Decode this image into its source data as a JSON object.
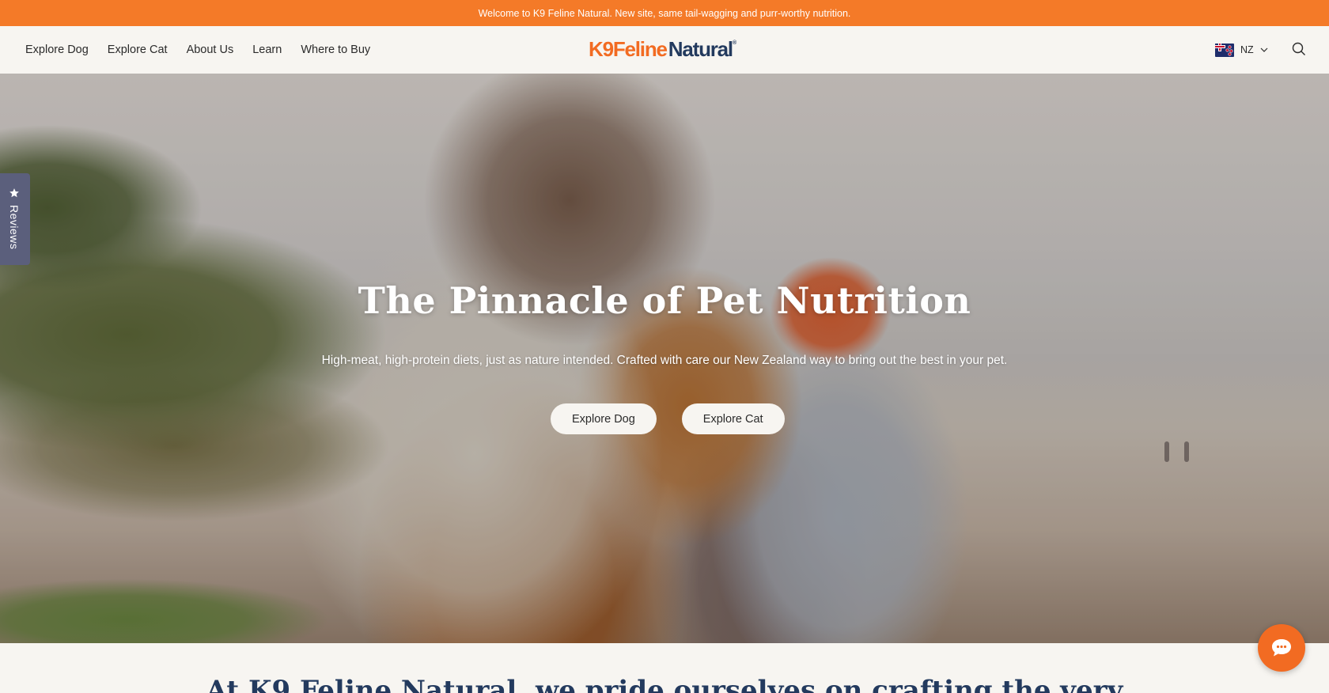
{
  "announcement": {
    "text": "Welcome to K9 Feline Natural. New site, same tail-wagging and purr-worthy nutrition."
  },
  "header": {
    "nav": [
      "Explore Dog",
      "Explore Cat",
      "About Us",
      "Learn",
      "Where to Buy"
    ],
    "logo": {
      "part1": "K9",
      "part2": "Feline",
      "part3": "Natural",
      "reg": "®"
    },
    "locale": {
      "code": "NZ",
      "flag_icon": "nz-flag-icon",
      "chevron_icon": "chevron-down-icon"
    },
    "search_icon": "search-icon"
  },
  "hero": {
    "title": "The Pinnacle of Pet Nutrition",
    "subtitle": "High-meat, high-protein diets, just as nature intended. Crafted with care our New Zealand way to bring out the best in your pet.",
    "buttons": [
      "Explore Dog",
      "Explore Cat"
    ]
  },
  "reviews_tab": {
    "label": "Reviews",
    "icon": "star-icon"
  },
  "below": {
    "heading": "At K9 Feline Natural, we pride ourselves on crafting the very"
  },
  "chat": {
    "icon": "chat-icon"
  },
  "colors": {
    "accent": "#f47a28",
    "navy": "#233a5e",
    "background": "#f7f5f1",
    "reviews_tab": "#5b5f7c"
  }
}
